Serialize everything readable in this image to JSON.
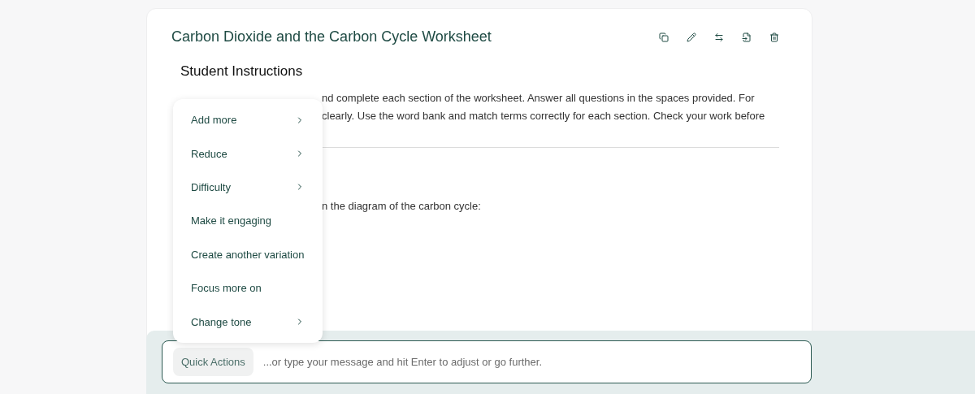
{
  "document": {
    "title": "Carbon Dioxide and the Carbon Cycle Worksheet",
    "section_heading": "Student Instructions",
    "visible_lines": [
      "nd complete each section of the worksheet. Answer all questions in the spaces provided. For",
      "clearly. Use the word bank and match terms correctly for each section. Check your work before"
    ],
    "question_fragment": "n the diagram of the carbon cycle:"
  },
  "toolbar": [
    {
      "kind": "copy"
    },
    {
      "kind": "edit"
    },
    {
      "kind": "swap"
    },
    {
      "kind": "export"
    },
    {
      "kind": "delete"
    }
  ],
  "menu": {
    "items": [
      {
        "label": "Add more",
        "submenu": true
      },
      {
        "label": "Reduce",
        "submenu": true
      },
      {
        "label": "Difficulty",
        "submenu": true
      },
      {
        "label": "Make it engaging",
        "submenu": false
      },
      {
        "label": "Create another variation",
        "submenu": false
      },
      {
        "label": "Focus more on",
        "submenu": false
      },
      {
        "label": "Change tone",
        "submenu": true
      }
    ]
  },
  "chat": {
    "quick_actions": "Quick Actions",
    "placeholder": "...or type your message and hit Enter to adjust or go further."
  }
}
